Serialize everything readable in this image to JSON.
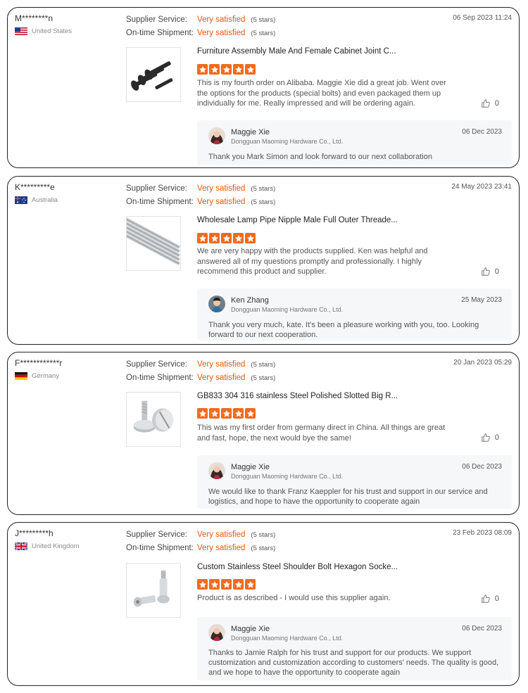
{
  "reviews": [
    {
      "buyer": "M********n",
      "country": "United States",
      "flag": "us",
      "service_label": "Supplier Service:",
      "service_value": "Very satisfied",
      "service_stars": "(5 stars)",
      "shipment_label": "On-time Shipment:",
      "shipment_value": "Very satisfied",
      "shipment_stars": "(5 stars)",
      "date": "06 Sep 2023 11:24",
      "product_image": "black-bolts-image",
      "product_title": "Furniture Assembly Male And Female Cabinet Joint C...",
      "rating": 5,
      "text": "This is my fourth order on Alibaba. Maggie Xie did a great job. Went over the options for the products (special bolts) and even packaged them up individually for me. Really impressed and will be ordering again.",
      "likes": "0",
      "reply": {
        "name": "Maggie Xie",
        "company": "Dongguan Maoming Hardware Co., Ltd.",
        "date": "06 Dec 2023",
        "text": "Thank you Mark Simon and look forward to our next collaboration"
      }
    },
    {
      "buyer": "K*********e",
      "country": "Australia",
      "flag": "au",
      "service_label": "Supplier Service:",
      "service_value": "Very satisfied",
      "service_stars": "(5 stars)",
      "shipment_label": "On-time Shipment:",
      "shipment_value": "Very satisfied",
      "shipment_stars": "(5 stars)",
      "date": "24 May 2023 23:41",
      "product_image": "steel-pipes-image",
      "product_title": "Wholesale Lamp Pipe Nipple Male Full Outer Threade...",
      "rating": 5,
      "text": "We are very happy with the products supplied. Ken was helpful and answered all of my questions promptly and professionally. I highly recommend this product and supplier.",
      "likes": "0",
      "reply": {
        "name": "Ken Zhang",
        "company": "Dongguan Maoming Hardware Co., Ltd.",
        "date": "25 May 2023",
        "text": "Thank you very much, kate. It's been a pleasure working with you, too. Looking forward to our next cooperation."
      }
    },
    {
      "buyer": "F************r",
      "country": "Germany",
      "flag": "de",
      "service_label": "Supplier Service:",
      "service_value": "Very satisfied",
      "service_stars": "(5 stars)",
      "shipment_label": "On-time Shipment:",
      "shipment_value": "Very satisfied",
      "shipment_stars": "(5 stars)",
      "date": "20 Jan 2023 05:29",
      "product_image": "slotted-screws-image",
      "product_title": "GB833 304 316 stainless Steel Polished Slotted Big R...",
      "rating": 5,
      "text": "This was my first order from germany direct in China. All things are great and fast, hope, the next would bye the same!",
      "likes": "0",
      "reply": {
        "name": "Maggie Xie",
        "company": "Dongguan Maoming Hardware Co., Ltd.",
        "date": "06 Dec 2023",
        "text": "We would like to thank Franz Kaeppler for his trust and support in our service and logistics, and hope to have the opportunity to cooperate again"
      }
    },
    {
      "buyer": "J*********h",
      "country": "United Kingdom",
      "flag": "uk",
      "service_label": "Supplier Service:",
      "service_value": "Very satisfied",
      "service_stars": "(5 stars)",
      "shipment_label": "On-time Shipment:",
      "shipment_value": "Very satisfied",
      "shipment_stars": "(5 stars)",
      "date": "23 Feb 2023 08:09",
      "product_image": "shoulder-bolts-image",
      "product_title": "Custom Stainless Steel Shoulder Bolt Hexagon Socke...",
      "rating": 5,
      "text": "Product is as described - I would use this supplier again.",
      "likes": "0",
      "reply": {
        "name": "Maggie Xie",
        "company": "Dongguan Maoming Hardware Co., Ltd.",
        "date": "06 Dec 2023",
        "text": "Thanks to Jamie Ralph for his trust and support for our products. We support customization and customization according to customers' needs. The quality is good, and we hope to have the opportunity to cooperate again"
      }
    }
  ]
}
